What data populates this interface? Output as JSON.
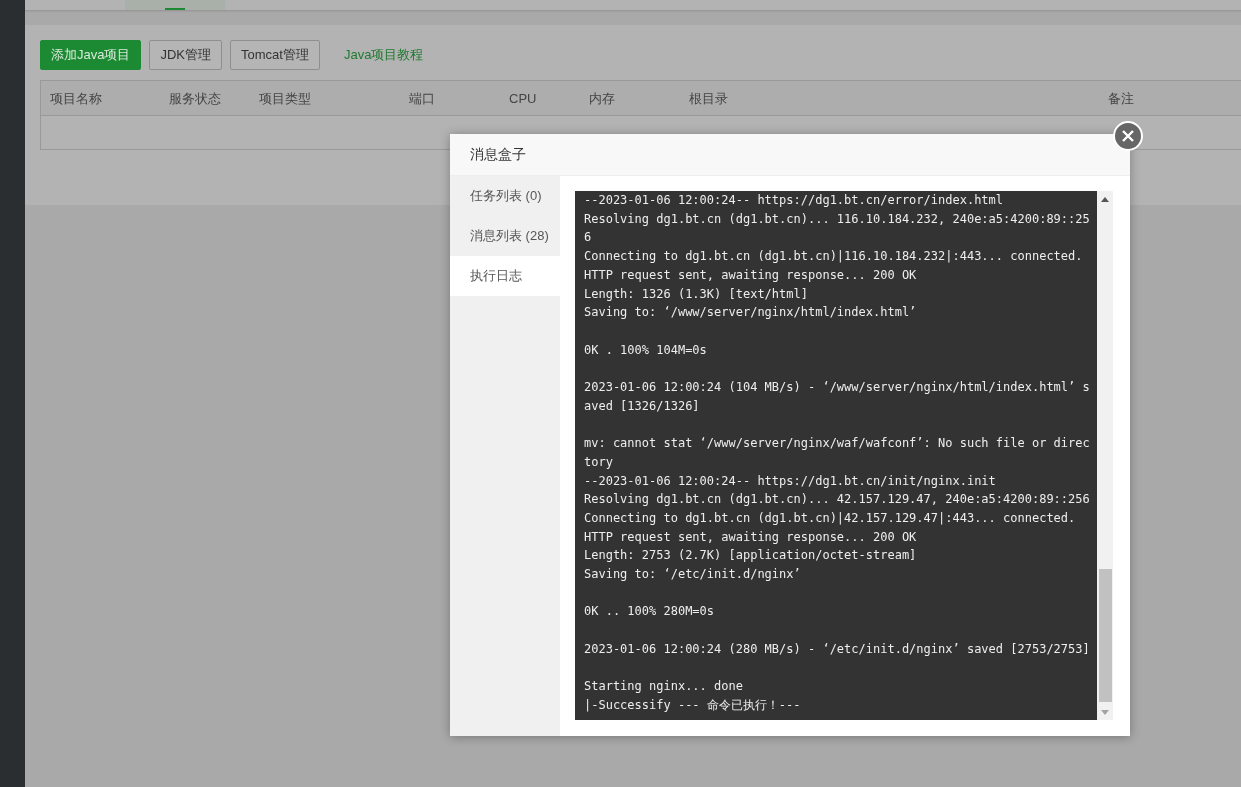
{
  "toolbar": {
    "buttons": [
      {
        "label": "添加Java项目",
        "kind": "primary"
      },
      {
        "label": "JDK管理",
        "kind": "default"
      },
      {
        "label": "Tomcat管理",
        "kind": "default"
      }
    ],
    "link": "Java项目教程"
  },
  "table": {
    "columns": [
      "项目名称",
      "服务状态",
      "项目类型",
      "端口",
      "CPU",
      "内存",
      "根目录",
      "备注"
    ]
  },
  "dialog": {
    "title": "消息盒子",
    "nav": [
      {
        "label": "任务列表 (0)",
        "selected": false
      },
      {
        "label": "消息列表 (28)",
        "selected": false
      },
      {
        "label": "执行日志",
        "selected": true
      }
    ],
    "log": [
      [
        "--2023-01-06 12:00:24-- https://dg1.bt.cn/error/index.html",
        "Resolving dg1.bt.cn (dg1.bt.cn)... 116.10.184.232, 240e:a5:4200:89::25",
        "6",
        "Connecting to dg1.bt.cn (dg1.bt.cn)|116.10.184.232|:443... connected.",
        "HTTP request sent, awaiting response... 200 OK",
        "Length: 1326 (1.3K) [text/html]",
        "Saving to: ‘/www/server/nginx/html/index.html’"
      ],
      [
        "0K . 100% 104M=0s"
      ],
      [
        "2023-01-06 12:00:24 (104 MB/s) - ‘/www/server/nginx/html/index.html’ s",
        "aved [1326/1326]"
      ],
      [
        "mv: cannot stat ‘/www/server/nginx/waf/wafconf’: No such file or direc",
        "tory",
        "--2023-01-06 12:00:24-- https://dg1.bt.cn/init/nginx.init",
        "Resolving dg1.bt.cn (dg1.bt.cn)... 42.157.129.47, 240e:a5:4200:89::256",
        "Connecting to dg1.bt.cn (dg1.bt.cn)|42.157.129.47|:443... connected.",
        "HTTP request sent, awaiting response... 200 OK",
        "Length: 2753 (2.7K) [application/octet-stream]",
        "Saving to: ‘/etc/init.d/nginx’"
      ],
      [
        "0K .. 100% 280M=0s"
      ],
      [
        "2023-01-06 12:00:24 (280 MB/s) - ‘/etc/init.d/nginx’ saved [2753/2753]"
      ],
      [
        "Starting nginx... done",
        "|-Successify --- 命令已执行！---"
      ]
    ]
  }
}
